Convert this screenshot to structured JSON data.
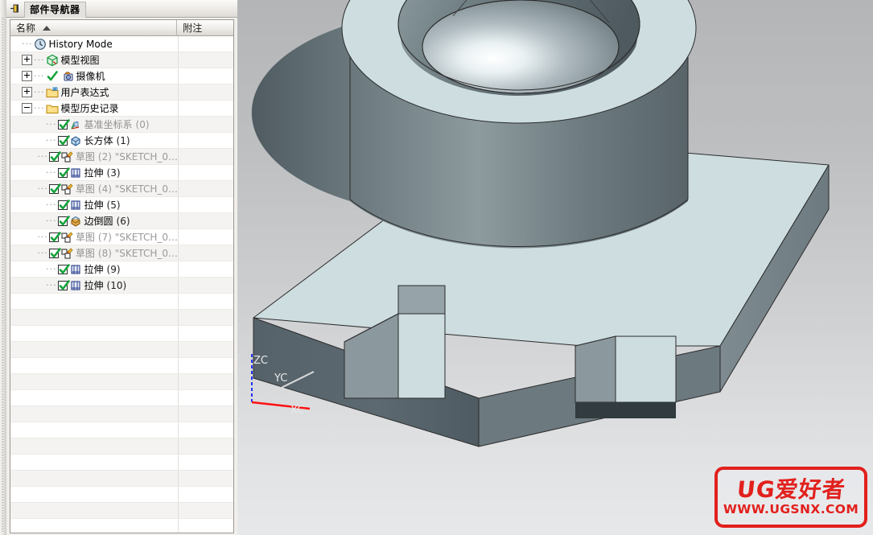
{
  "panel": {
    "title": "部件导航器",
    "pin_icon": "pin-icon",
    "columns": [
      {
        "label": "名称",
        "sort": "ascending"
      },
      {
        "label": "附注"
      }
    ]
  },
  "tree": {
    "items": [
      {
        "depth": 0,
        "expander": "none",
        "check": "none",
        "icon": "clock-icon",
        "label": "History Mode",
        "suffix": "",
        "dim": false
      },
      {
        "depth": 0,
        "expander": "collapsed",
        "check": "none",
        "icon": "model-view-icon",
        "label": "模型视图",
        "suffix": "",
        "dim": false
      },
      {
        "depth": 0,
        "expander": "collapsed",
        "check": "green",
        "icon": "camera-icon",
        "label": "摄像机",
        "suffix": "",
        "dim": false
      },
      {
        "depth": 0,
        "expander": "collapsed",
        "check": "none",
        "icon": "folder-expr-icon",
        "label": "用户表达式",
        "suffix": "",
        "dim": false
      },
      {
        "depth": 0,
        "expander": "expanded",
        "check": "none",
        "icon": "folder-icon",
        "label": "模型历史记录",
        "suffix": "",
        "dim": false
      },
      {
        "depth": 1,
        "expander": "none",
        "check": "checked",
        "icon": "datum-csys-icon",
        "label": "基准坐标系",
        "suffix": "(0)",
        "dim": true
      },
      {
        "depth": 1,
        "expander": "none",
        "check": "checked",
        "icon": "block-icon",
        "label": "长方体",
        "suffix": "(1)",
        "dim": false
      },
      {
        "depth": 1,
        "expander": "none",
        "check": "checked",
        "icon": "sketch-icon",
        "label": "草图",
        "suffix": "(2) \"SKETCH_0…",
        "dim": true
      },
      {
        "depth": 1,
        "expander": "none",
        "check": "checked",
        "icon": "extrude-icon",
        "label": "拉伸",
        "suffix": "(3)",
        "dim": false
      },
      {
        "depth": 1,
        "expander": "none",
        "check": "checked",
        "icon": "sketch-icon",
        "label": "草图",
        "suffix": "(4) \"SKETCH_0…",
        "dim": true
      },
      {
        "depth": 1,
        "expander": "none",
        "check": "checked",
        "icon": "extrude-icon",
        "label": "拉伸",
        "suffix": "(5)",
        "dim": false
      },
      {
        "depth": 1,
        "expander": "none",
        "check": "checked",
        "icon": "edge-blend-icon",
        "label": "边倒圆",
        "suffix": "(6)",
        "dim": false
      },
      {
        "depth": 1,
        "expander": "none",
        "check": "checked",
        "icon": "sketch-icon",
        "label": "草图",
        "suffix": "(7) \"SKETCH_0…",
        "dim": true
      },
      {
        "depth": 1,
        "expander": "none",
        "check": "checked",
        "icon": "sketch-icon",
        "label": "草图",
        "suffix": "(8) \"SKETCH_0…",
        "dim": true
      },
      {
        "depth": 1,
        "expander": "none",
        "check": "checked",
        "icon": "extrude-icon",
        "label": "拉伸",
        "suffix": "(9)",
        "dim": false
      },
      {
        "depth": 1,
        "expander": "none",
        "check": "checked",
        "icon": "extrude-icon",
        "label": "拉伸",
        "suffix": "(10)",
        "dim": false
      }
    ],
    "empty_row_count": 15
  },
  "viewport": {
    "triad": {
      "zc_label": "ZC",
      "yc_label": "YC",
      "xc_label": "XC",
      "zc_color": "#2030ff",
      "yc_color": "#d8d8d8",
      "xc_color": "#ff1010"
    },
    "model": {
      "face_light": "#cdddE0",
      "face_mid": "#8a9a9e",
      "face_dark": "#5a666b",
      "edge_color": "#2b2b2b"
    },
    "background_top": "#b3b5b7",
    "background_bottom": "#e7e8ea"
  },
  "watermark": {
    "line1": "UG爱好者",
    "line2": "WWW.UGSNX.COM",
    "color": "#e2201c"
  }
}
